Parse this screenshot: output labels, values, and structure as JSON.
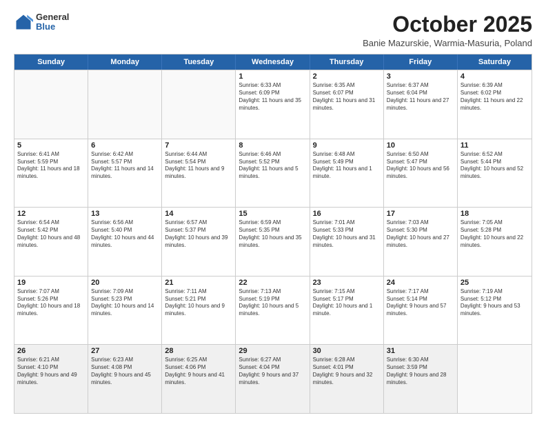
{
  "header": {
    "logo_general": "General",
    "logo_blue": "Blue",
    "month_title": "October 2025",
    "location": "Banie Mazurskie, Warmia-Masuria, Poland"
  },
  "days_of_week": [
    "Sunday",
    "Monday",
    "Tuesday",
    "Wednesday",
    "Thursday",
    "Friday",
    "Saturday"
  ],
  "rows": [
    [
      {
        "day": "",
        "sunrise": "",
        "sunset": "",
        "daylight": "",
        "empty": true
      },
      {
        "day": "",
        "sunrise": "",
        "sunset": "",
        "daylight": "",
        "empty": true
      },
      {
        "day": "",
        "sunrise": "",
        "sunset": "",
        "daylight": "",
        "empty": true
      },
      {
        "day": "1",
        "sunrise": "Sunrise: 6:33 AM",
        "sunset": "Sunset: 6:09 PM",
        "daylight": "Daylight: 11 hours and 35 minutes."
      },
      {
        "day": "2",
        "sunrise": "Sunrise: 6:35 AM",
        "sunset": "Sunset: 6:07 PM",
        "daylight": "Daylight: 11 hours and 31 minutes."
      },
      {
        "day": "3",
        "sunrise": "Sunrise: 6:37 AM",
        "sunset": "Sunset: 6:04 PM",
        "daylight": "Daylight: 11 hours and 27 minutes."
      },
      {
        "day": "4",
        "sunrise": "Sunrise: 6:39 AM",
        "sunset": "Sunset: 6:02 PM",
        "daylight": "Daylight: 11 hours and 22 minutes."
      }
    ],
    [
      {
        "day": "5",
        "sunrise": "Sunrise: 6:41 AM",
        "sunset": "Sunset: 5:59 PM",
        "daylight": "Daylight: 11 hours and 18 minutes."
      },
      {
        "day": "6",
        "sunrise": "Sunrise: 6:42 AM",
        "sunset": "Sunset: 5:57 PM",
        "daylight": "Daylight: 11 hours and 14 minutes."
      },
      {
        "day": "7",
        "sunrise": "Sunrise: 6:44 AM",
        "sunset": "Sunset: 5:54 PM",
        "daylight": "Daylight: 11 hours and 9 minutes."
      },
      {
        "day": "8",
        "sunrise": "Sunrise: 6:46 AM",
        "sunset": "Sunset: 5:52 PM",
        "daylight": "Daylight: 11 hours and 5 minutes."
      },
      {
        "day": "9",
        "sunrise": "Sunrise: 6:48 AM",
        "sunset": "Sunset: 5:49 PM",
        "daylight": "Daylight: 11 hours and 1 minute."
      },
      {
        "day": "10",
        "sunrise": "Sunrise: 6:50 AM",
        "sunset": "Sunset: 5:47 PM",
        "daylight": "Daylight: 10 hours and 56 minutes."
      },
      {
        "day": "11",
        "sunrise": "Sunrise: 6:52 AM",
        "sunset": "Sunset: 5:44 PM",
        "daylight": "Daylight: 10 hours and 52 minutes."
      }
    ],
    [
      {
        "day": "12",
        "sunrise": "Sunrise: 6:54 AM",
        "sunset": "Sunset: 5:42 PM",
        "daylight": "Daylight: 10 hours and 48 minutes."
      },
      {
        "day": "13",
        "sunrise": "Sunrise: 6:56 AM",
        "sunset": "Sunset: 5:40 PM",
        "daylight": "Daylight: 10 hours and 44 minutes."
      },
      {
        "day": "14",
        "sunrise": "Sunrise: 6:57 AM",
        "sunset": "Sunset: 5:37 PM",
        "daylight": "Daylight: 10 hours and 39 minutes."
      },
      {
        "day": "15",
        "sunrise": "Sunrise: 6:59 AM",
        "sunset": "Sunset: 5:35 PM",
        "daylight": "Daylight: 10 hours and 35 minutes."
      },
      {
        "day": "16",
        "sunrise": "Sunrise: 7:01 AM",
        "sunset": "Sunset: 5:33 PM",
        "daylight": "Daylight: 10 hours and 31 minutes."
      },
      {
        "day": "17",
        "sunrise": "Sunrise: 7:03 AM",
        "sunset": "Sunset: 5:30 PM",
        "daylight": "Daylight: 10 hours and 27 minutes."
      },
      {
        "day": "18",
        "sunrise": "Sunrise: 7:05 AM",
        "sunset": "Sunset: 5:28 PM",
        "daylight": "Daylight: 10 hours and 22 minutes."
      }
    ],
    [
      {
        "day": "19",
        "sunrise": "Sunrise: 7:07 AM",
        "sunset": "Sunset: 5:26 PM",
        "daylight": "Daylight: 10 hours and 18 minutes."
      },
      {
        "day": "20",
        "sunrise": "Sunrise: 7:09 AM",
        "sunset": "Sunset: 5:23 PM",
        "daylight": "Daylight: 10 hours and 14 minutes."
      },
      {
        "day": "21",
        "sunrise": "Sunrise: 7:11 AM",
        "sunset": "Sunset: 5:21 PM",
        "daylight": "Daylight: 10 hours and 9 minutes."
      },
      {
        "day": "22",
        "sunrise": "Sunrise: 7:13 AM",
        "sunset": "Sunset: 5:19 PM",
        "daylight": "Daylight: 10 hours and 5 minutes."
      },
      {
        "day": "23",
        "sunrise": "Sunrise: 7:15 AM",
        "sunset": "Sunset: 5:17 PM",
        "daylight": "Daylight: 10 hours and 1 minute."
      },
      {
        "day": "24",
        "sunrise": "Sunrise: 7:17 AM",
        "sunset": "Sunset: 5:14 PM",
        "daylight": "Daylight: 9 hours and 57 minutes."
      },
      {
        "day": "25",
        "sunrise": "Sunrise: 7:19 AM",
        "sunset": "Sunset: 5:12 PM",
        "daylight": "Daylight: 9 hours and 53 minutes."
      }
    ],
    [
      {
        "day": "26",
        "sunrise": "Sunrise: 6:21 AM",
        "sunset": "Sunset: 4:10 PM",
        "daylight": "Daylight: 9 hours and 49 minutes."
      },
      {
        "day": "27",
        "sunrise": "Sunrise: 6:23 AM",
        "sunset": "Sunset: 4:08 PM",
        "daylight": "Daylight: 9 hours and 45 minutes."
      },
      {
        "day": "28",
        "sunrise": "Sunrise: 6:25 AM",
        "sunset": "Sunset: 4:06 PM",
        "daylight": "Daylight: 9 hours and 41 minutes."
      },
      {
        "day": "29",
        "sunrise": "Sunrise: 6:27 AM",
        "sunset": "Sunset: 4:04 PM",
        "daylight": "Daylight: 9 hours and 37 minutes."
      },
      {
        "day": "30",
        "sunrise": "Sunrise: 6:28 AM",
        "sunset": "Sunset: 4:01 PM",
        "daylight": "Daylight: 9 hours and 32 minutes."
      },
      {
        "day": "31",
        "sunrise": "Sunrise: 6:30 AM",
        "sunset": "Sunset: 3:59 PM",
        "daylight": "Daylight: 9 hours and 28 minutes."
      },
      {
        "day": "",
        "sunrise": "",
        "sunset": "",
        "daylight": "",
        "empty": true
      }
    ]
  ]
}
